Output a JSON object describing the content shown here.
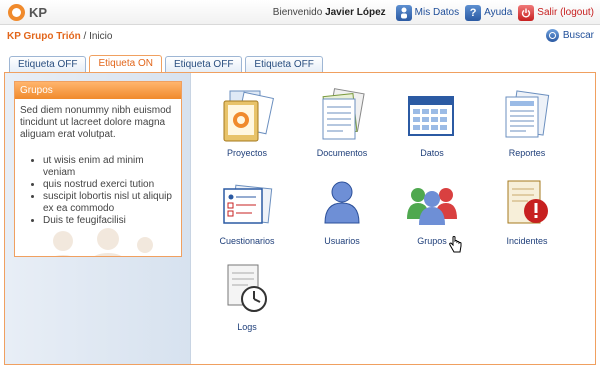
{
  "brand": {
    "logo_text": "KP"
  },
  "userbar": {
    "welcome": "Bienvenido",
    "user": "Javier López",
    "mis_datos": "Mis Datos",
    "ayuda": "Ayuda",
    "salir": "Salir (logout)"
  },
  "breadcrumb": {
    "home": "KP Grupo Trión",
    "separator": "/",
    "current": "Inicio"
  },
  "search": {
    "label": "Buscar"
  },
  "tabs": [
    {
      "label": "Etiqueta OFF",
      "active": false
    },
    {
      "label": "Etiqueta ON",
      "active": true
    },
    {
      "label": "Etiqueta OFF",
      "active": false
    },
    {
      "label": "Etiqueta OFF",
      "active": false
    }
  ],
  "sidebar": {
    "title": "Grupos",
    "text": "Sed diem nonummy nibh euismod tincidunt ut lacreet dolore magna aliguam erat volutpat.",
    "items": [
      "ut wisis enim ad minim veniam",
      "quis nostrud exerci tution",
      "suscipit lobortis nisl ut aliquip ex ea commodo",
      "Duis te feugifacilisi"
    ]
  },
  "apps": [
    {
      "label": "Proyectos",
      "icon": "projects-icon"
    },
    {
      "label": "Documentos",
      "icon": "documents-icon"
    },
    {
      "label": "Datos",
      "icon": "data-calendar-icon"
    },
    {
      "label": "Reportes",
      "icon": "reports-icon"
    },
    {
      "label": "Cuestionarios",
      "icon": "checklist-icon"
    },
    {
      "label": "Usuarios",
      "icon": "user-icon"
    },
    {
      "label": "Grupos",
      "icon": "groups-icon"
    },
    {
      "label": "Incidentes",
      "icon": "incident-warning-icon"
    },
    {
      "label": "Logs",
      "icon": "logs-clock-icon"
    }
  ],
  "colors": {
    "accent": "#f08a2c",
    "link": "#1f4e99",
    "tab_border": "#9eb6d4"
  }
}
